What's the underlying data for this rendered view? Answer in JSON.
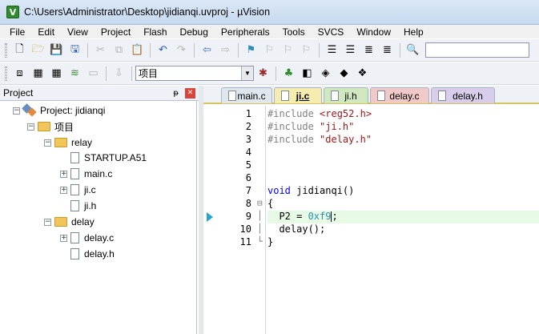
{
  "window": {
    "title": "C:\\Users\\Administrator\\Desktop\\jidianqi.uvproj - µVision",
    "app_icon": "uvision-icon"
  },
  "menu": [
    "File",
    "Edit",
    "View",
    "Project",
    "Flash",
    "Debug",
    "Peripherals",
    "Tools",
    "SVCS",
    "Window",
    "Help"
  ],
  "toolbar": {
    "target_select": "项目"
  },
  "project_panel": {
    "title": "Project",
    "pin_glyph": "ᵽ",
    "close_glyph": "✕",
    "tree": {
      "root": "Project: jidianqi",
      "target": "项目",
      "groups": [
        {
          "name": "relay",
          "files": [
            "STARTUP.A51",
            "main.c",
            "ji.c",
            "ji.h"
          ]
        },
        {
          "name": "delay",
          "files": [
            "delay.c",
            "delay.h"
          ]
        }
      ]
    }
  },
  "tabs": [
    {
      "label": "main.c",
      "color": "#dfe6ee",
      "active": false
    },
    {
      "label": "ji.c",
      "color": "#f5ecb0",
      "active": true
    },
    {
      "label": "ji.h",
      "color": "#cfe8bf",
      "active": false
    },
    {
      "label": "delay.c",
      "color": "#f2c9c9",
      "active": false
    },
    {
      "label": "delay.h",
      "color": "#d8cdea",
      "active": false
    }
  ],
  "editor": {
    "current_line": 9,
    "lines": [
      {
        "n": "1",
        "text": "#include <reg52.h>"
      },
      {
        "n": "2",
        "text": "#include \"ji.h\""
      },
      {
        "n": "3",
        "text": "#include \"delay.h\""
      },
      {
        "n": "4",
        "text": ""
      },
      {
        "n": "5",
        "text": ""
      },
      {
        "n": "6",
        "text": ""
      },
      {
        "n": "7",
        "text": "void jidianqi()"
      },
      {
        "n": "8",
        "text": "{"
      },
      {
        "n": "9",
        "text": "  P2 = 0xf9;"
      },
      {
        "n": "10",
        "text": "  delay();"
      },
      {
        "n": "11",
        "text": "}"
      }
    ]
  },
  "colors": {
    "preprocessor": "#808080",
    "include_path": "#a31515",
    "keyword": "#0000ff",
    "number": "#2b91af",
    "current_line_bg": "#e6fae6"
  }
}
